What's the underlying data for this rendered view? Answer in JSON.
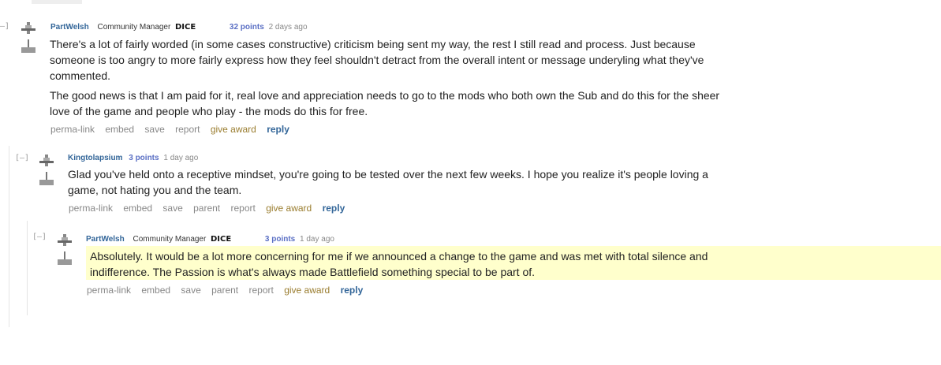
{
  "comments": [
    {
      "collapse": "[–]",
      "author": "PartWelsh",
      "flair": "Community Manager",
      "dice_logo": "DICE",
      "score": "32 points",
      "time": "2 days ago",
      "paragraphs": [
        "There's a lot of fairly worded (in some cases constructive) criticism being sent my way, the rest I still read and process. Just because someone is too angry to more fairly express how they feel shouldn't detract from the overall intent or message underyling what they've commented.",
        "The good news is that I am paid for it, real love and appreciation needs to go to the mods who both own the Sub and do this for the sheer love of the game and people who play - the mods do this for free."
      ],
      "buttons": {
        "permalink": "perma-link",
        "embed": "embed",
        "save": "save",
        "report": "report",
        "give_award": "give award",
        "reply": "reply"
      }
    },
    {
      "collapse": "[–]",
      "author": "Kingtolapsium",
      "score": "3 points",
      "time": "1 day ago",
      "paragraphs": [
        "Glad you've held onto a receptive mindset, you're going to be tested over the next few weeks. I hope you realize it's people loving a game, not hating you and the team."
      ],
      "buttons": {
        "permalink": "perma-link",
        "embed": "embed",
        "save": "save",
        "parent": "parent",
        "report": "report",
        "give_award": "give award",
        "reply": "reply"
      }
    },
    {
      "collapse": "[–]",
      "author": "PartWelsh",
      "flair": "Community Manager",
      "dice_logo": "DICE",
      "score": "3 points",
      "time": "1 day ago",
      "paragraphs": [
        "Absolutely. It would be a lot more concerning for me if we announced a change to the game and was met with total silence and indifference. The Passion is what's always made Battlefield something special to be part of."
      ],
      "buttons": {
        "permalink": "perma-link",
        "embed": "embed",
        "save": "save",
        "parent": "parent",
        "report": "report",
        "give_award": "give award",
        "reply": "reply"
      }
    }
  ]
}
